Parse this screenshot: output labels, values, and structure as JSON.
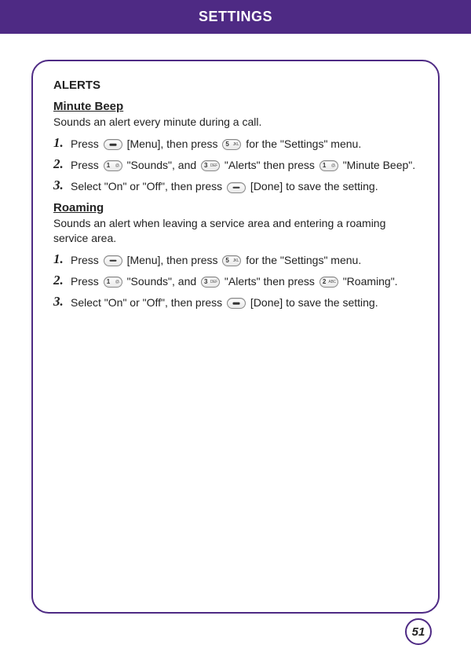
{
  "header": {
    "title": "SETTINGS"
  },
  "section": {
    "heading": "ALERTS"
  },
  "minuteBeep": {
    "heading": "Minute Beep",
    "desc": "Sounds an alert every minute during a call.",
    "steps": [
      {
        "n": "1.",
        "parts": [
          {
            "t": "Press "
          },
          {
            "key": "dash"
          },
          {
            "t": " [Menu], then press "
          },
          {
            "key": "5",
            "sub": "JKL"
          },
          {
            "t": " for the \"Settings\" menu."
          }
        ]
      },
      {
        "n": "2.",
        "parts": [
          {
            "t": "Press "
          },
          {
            "key": "1",
            "sub": "@."
          },
          {
            "t": " \"Sounds\", and "
          },
          {
            "key": "3",
            "sub": "DEF"
          },
          {
            "t": " \"Alerts\" then press "
          },
          {
            "key": "1",
            "sub": "@."
          },
          {
            "t": " \"Minute Beep\"."
          }
        ]
      },
      {
        "n": "3.",
        "parts": [
          {
            "t": "Select \"On\" or \"Off\", then press "
          },
          {
            "key": "dash"
          },
          {
            "t": " [Done] to save the setting."
          }
        ]
      }
    ]
  },
  "roaming": {
    "heading": "Roaming",
    "desc": "Sounds an alert when leaving a service area and entering a roaming service area.",
    "steps": [
      {
        "n": "1.",
        "parts": [
          {
            "t": "Press "
          },
          {
            "key": "dash"
          },
          {
            "t": " [Menu], then press "
          },
          {
            "key": "5",
            "sub": "JKL"
          },
          {
            "t": " for the \"Settings\" menu."
          }
        ]
      },
      {
        "n": "2.",
        "parts": [
          {
            "t": "Press "
          },
          {
            "key": "1",
            "sub": "@."
          },
          {
            "t": " \"Sounds\", and "
          },
          {
            "key": "3",
            "sub": "DEF"
          },
          {
            "t": " \"Alerts\" then press "
          },
          {
            "key": "2",
            "sub": "ABC"
          },
          {
            "t": " \"Roaming\"."
          }
        ]
      },
      {
        "n": "3.",
        "parts": [
          {
            "t": "Select \"On\" or \"Off\", then press "
          },
          {
            "key": "dash"
          },
          {
            "t": " [Done] to save the setting."
          }
        ]
      }
    ]
  },
  "pageNumber": "51"
}
